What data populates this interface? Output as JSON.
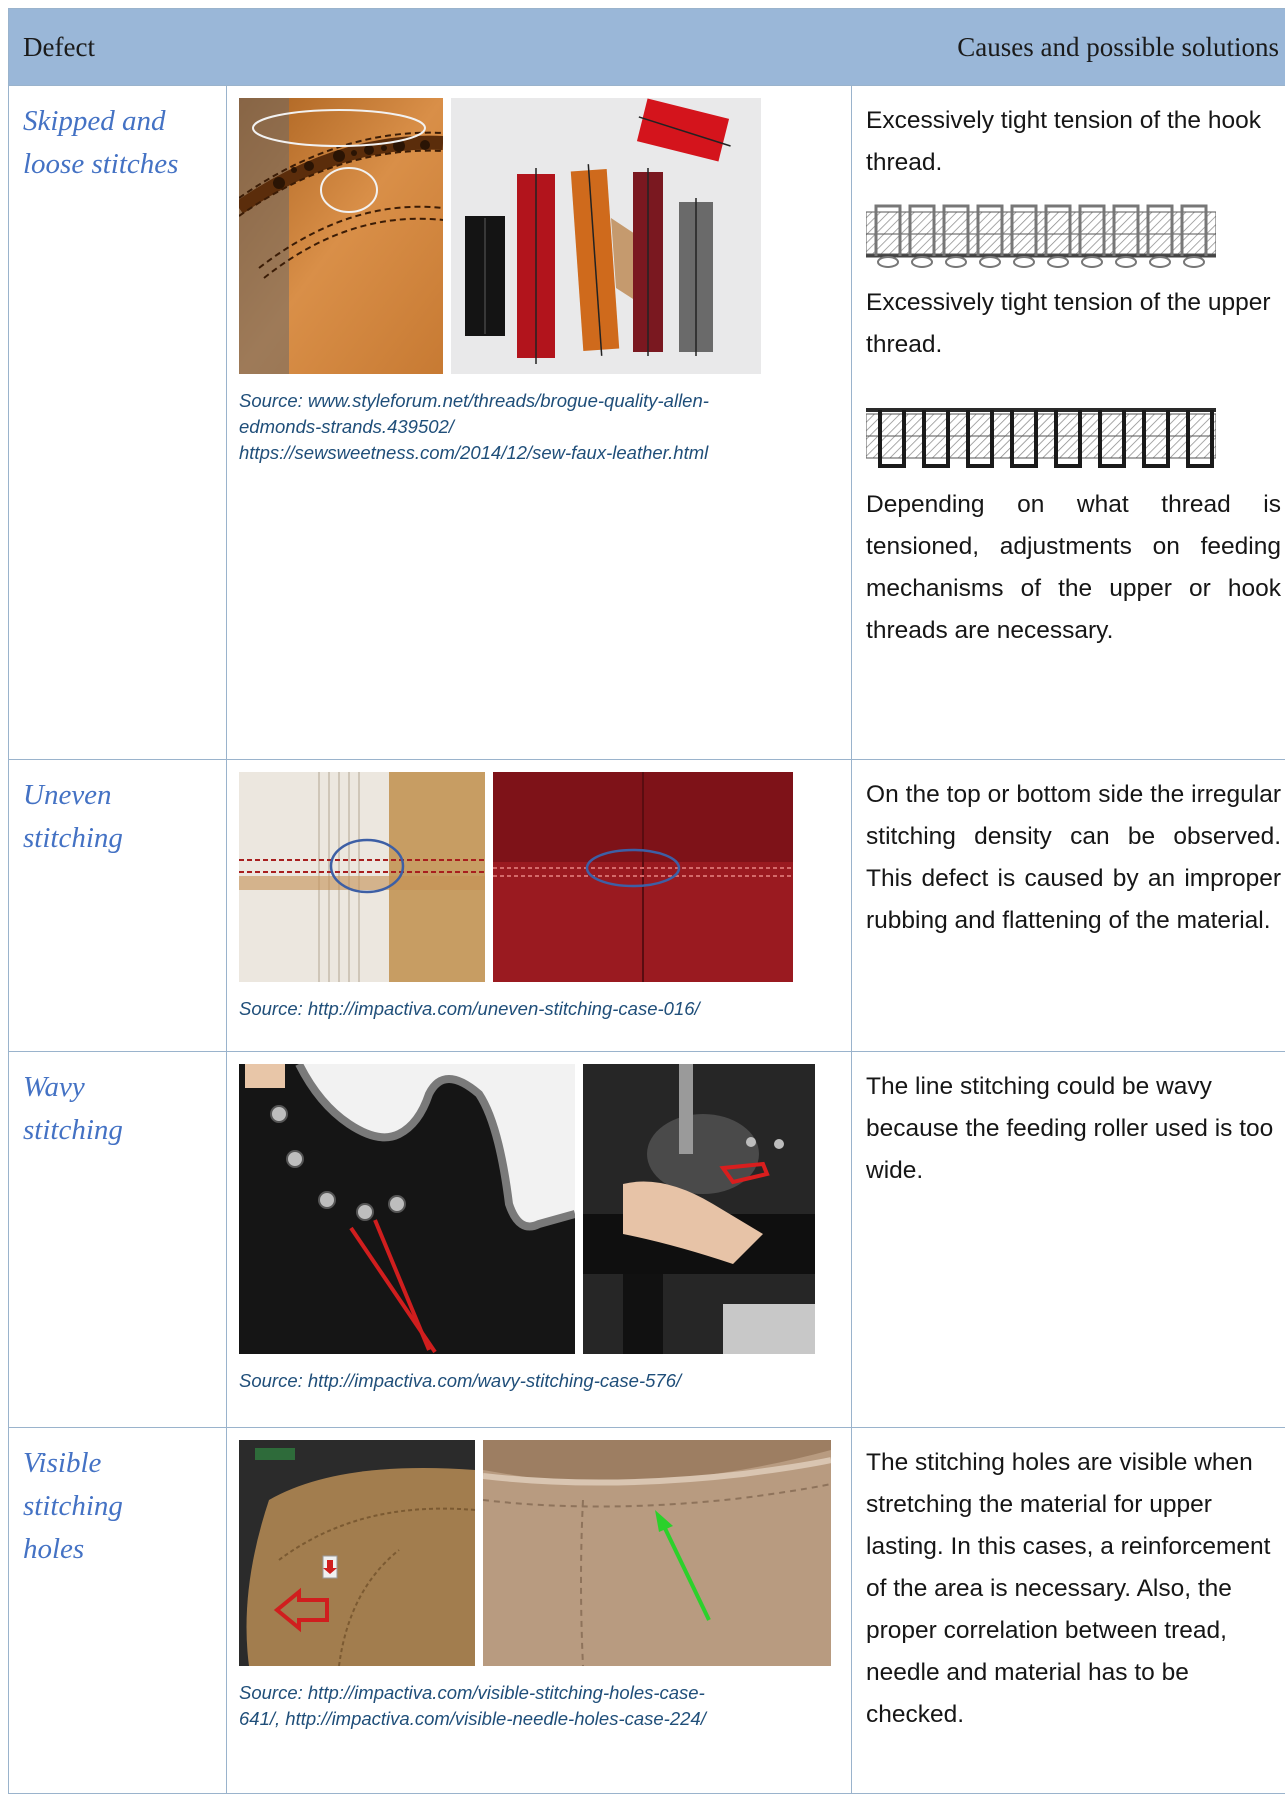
{
  "header": {
    "col_defect": "Defect",
    "col_causes": "Causes and possible solutions"
  },
  "rows": [
    {
      "defect_line1": "Skipped and",
      "defect_line2": "loose stitches",
      "causes_a": "Excessively tight tension of the hook thread.",
      "causes_b": "Excessively tight tension of the upper thread.",
      "causes_c": "Depending on what thread is tensioned, adjustments on feeding mechanisms of the upper or hook threads are necessary.",
      "source_line1": "Source: www.styleforum.net/threads/brogue-quality-allen-",
      "source_line2": "edmonds-strands.439502/",
      "source_line3": "https://sewsweetness.com/2014/12/sew-faux-leather.html"
    },
    {
      "defect_line1": "Uneven",
      "defect_line2": "stitching",
      "causes": "On the top or bottom side the irregular stitching density can be observed.  This defect is caused by an improper rubbing and flattening of the material.",
      "source_line1": "Source: http://impactiva.com/uneven-stitching-case-016/"
    },
    {
      "defect_line1": "Wavy",
      "defect_line2": "stitching",
      "causes": "The line stitching could be wavy because the feeding roller used is too wide.",
      "source_line1": "Source: http://impactiva.com/wavy-stitching-case-576/"
    },
    {
      "defect_line1": "Visible",
      "defect_line2": "stitching",
      "defect_line3": "holes",
      "causes": "The stitching holes are visible when stretching the material for upper lasting. In this cases, a reinforcement of the area is necessary. Also, the proper correlation between tread, needle and material has to be checked.",
      "source_line1": "Source: http://impactiva.com/visible-stitching-holes-case-",
      "source_line2": "641/, http://impactiva.com/visible-needle-holes-case-224/"
    }
  ],
  "colors": {
    "header_bg": "#9ab7d8",
    "border": "#9ab3cc",
    "defect_text": "#4472c4",
    "source_text": "#1f4e79"
  }
}
